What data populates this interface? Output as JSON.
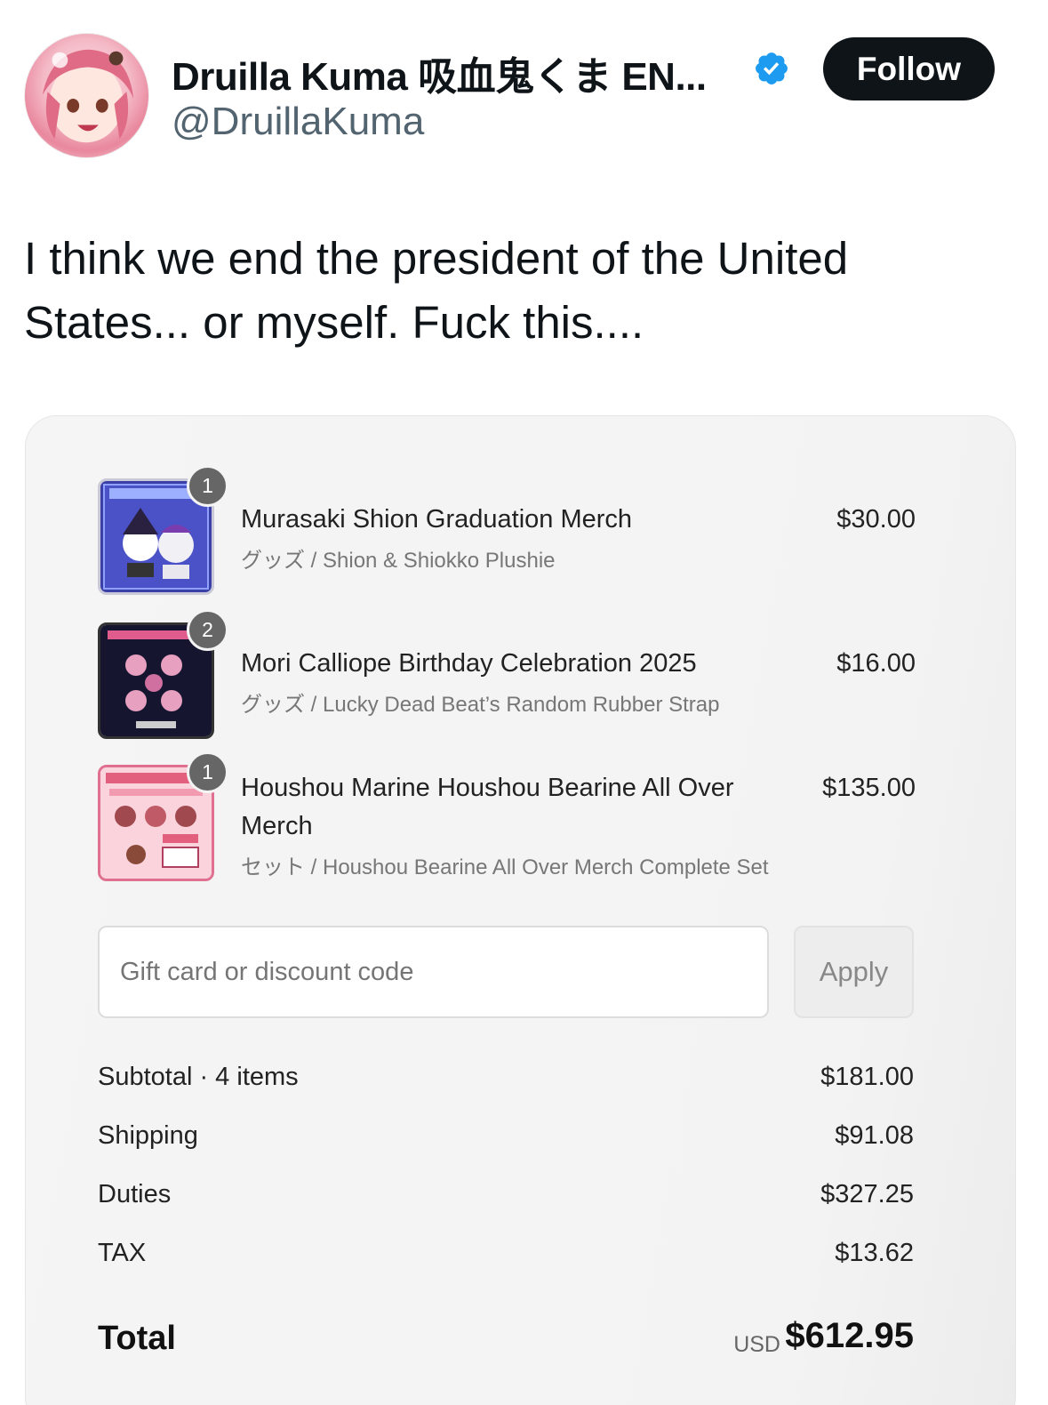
{
  "header": {
    "display_name": "Druilla Kuma 吸血鬼くま EN...",
    "handle": "@DruillaKuma",
    "follow_label": "Follow"
  },
  "tweet": {
    "text": "I think we end the president of the United States... or myself. Fuck this...."
  },
  "cart": {
    "items": [
      {
        "quantity": "1",
        "name": "Murasaki Shion Graduation Merch",
        "variant": "グッズ / Shion & Shiokko Plushie",
        "price": "$30.00"
      },
      {
        "quantity": "2",
        "name": "Mori Calliope Birthday Celebration 2025",
        "variant": "グッズ / Lucky Dead Beat’s Random Rubber Strap",
        "price": "$16.00"
      },
      {
        "quantity": "1",
        "name": "Houshou Marine Houshou Bearine All Over Merch",
        "variant": "セット / Houshou Bearine All Over Merch Complete Set",
        "price": "$135.00"
      }
    ],
    "discount": {
      "placeholder": "Gift card or discount code",
      "apply_label": "Apply"
    },
    "summary": {
      "subtotal_label": "Subtotal · 4 items",
      "subtotal_value": "$181.00",
      "shipping_label": "Shipping",
      "shipping_value": "$91.08",
      "duties_label": "Duties",
      "duties_value": "$327.25",
      "tax_label": "TAX",
      "tax_value": "$13.62",
      "total_label": "Total",
      "total_currency": "USD",
      "total_value": "$612.95"
    }
  },
  "colors": {
    "verified": "#1d9bf0",
    "follow_bg": "#0f1419",
    "handle": "#536471",
    "card_bg": "#f4f4f4"
  },
  "icons": {
    "verified": "verified-badge-icon"
  }
}
